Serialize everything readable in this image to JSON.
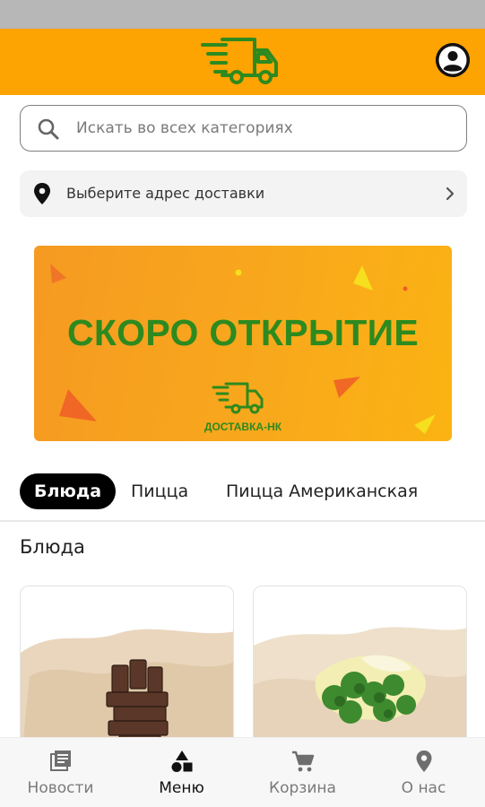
{
  "header": {
    "logo_icon": "delivery-truck-icon",
    "profile_icon": "account-circle-icon",
    "brand_color": "#fda302"
  },
  "search": {
    "placeholder": "Искать во всех категориях",
    "icon": "search-icon"
  },
  "address": {
    "label": "Выберите адрес доставки",
    "icon": "location-pin-icon"
  },
  "banner": {
    "title": "СКОРО ОТКРЫТИЕ",
    "subtitle": "ДОСТАВКА-НК",
    "accent": "#2d8a1f"
  },
  "tabs": [
    {
      "label": "Блюда",
      "active": true
    },
    {
      "label": "Пицца",
      "active": false
    },
    {
      "label": "Пицца Американская",
      "active": false
    }
  ],
  "section": {
    "title": "Блюда"
  },
  "products": [
    {
      "image": "chocolate-dessert-on-parchment"
    },
    {
      "image": "broccoli-with-cheese-on-parchment"
    }
  ],
  "bottom_nav": [
    {
      "label": "Новости",
      "icon": "news-icon",
      "active": false
    },
    {
      "label": "Меню",
      "icon": "shapes-icon",
      "active": true
    },
    {
      "label": "Корзина",
      "icon": "cart-icon",
      "active": false
    },
    {
      "label": "О нас",
      "icon": "location-pin-icon",
      "active": false
    }
  ]
}
